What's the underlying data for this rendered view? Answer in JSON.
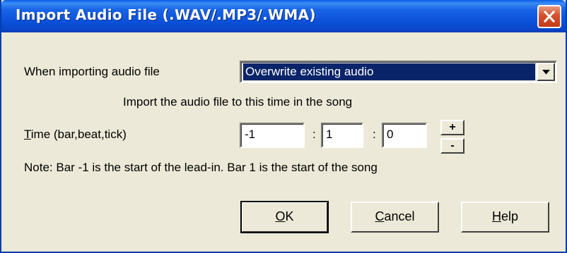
{
  "window": {
    "title": "Import Audio File (.WAV/.MP3/.WMA)"
  },
  "import_mode": {
    "label": "When importing audio file",
    "selected": "Overwrite existing audio"
  },
  "time_section": {
    "heading": "Import the audio file to this time in the song",
    "label_mnemonic": "T",
    "label_rest": "ime (bar,beat,tick)",
    "bar": "-1",
    "beat": "1",
    "tick": "0",
    "separator": ":",
    "increment": "+",
    "decrement": "-",
    "note": "Note: Bar -1 is the start of the lead-in. Bar 1 is the start of the song"
  },
  "buttons": {
    "ok_mnemonic": "O",
    "ok_rest": "K",
    "cancel_mnemonic": "C",
    "cancel_rest": "ancel",
    "help_mnemonic": "H",
    "help_rest": "elp"
  },
  "colors": {
    "titlebar": "#0a4fd8",
    "close_button": "#d4502c",
    "selection": "#0a246a",
    "dialog_face": "#ece9d8"
  }
}
